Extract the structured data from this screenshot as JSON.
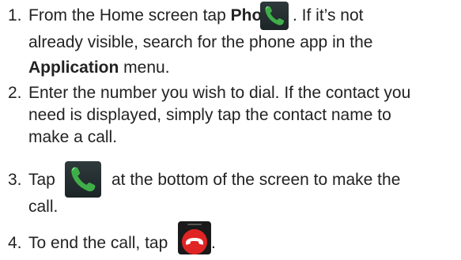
{
  "steps": [
    {
      "number": "1.",
      "line1_pre": "From the Home screen tap ",
      "line1_bold": "Phone",
      "line1_post": ". If it’s not",
      "line2": "already visible, search for the phone app in the",
      "line3_bold": "Application",
      "line3_post": " menu.",
      "icon": "phone-icon"
    },
    {
      "number": "2.",
      "line1": "Enter the number you wish to dial. If the contact you",
      "line2": "need is displayed, simply tap the contact name to",
      "line3": "make a call."
    },
    {
      "number": "3.",
      "line1_pre": "Tap",
      "line1_post": "at the bottom of the screen to make the",
      "line2": "call.",
      "icon": "phone-icon"
    },
    {
      "number": "4.",
      "line1_pre": "To end the call, tap",
      "line1_post": ".",
      "icon": "end-call-icon"
    }
  ],
  "colors": {
    "text": "#222222",
    "phone_green": "#3fae49",
    "end_call_red": "#e02424"
  }
}
